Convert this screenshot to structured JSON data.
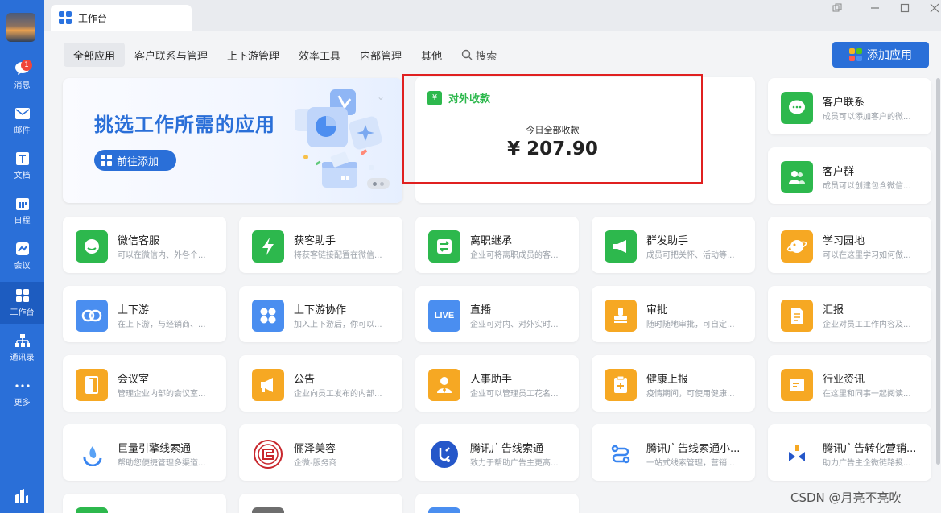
{
  "sidebar": {
    "items": [
      {
        "label": "消息",
        "icon": "chat-icon",
        "badge": "1"
      },
      {
        "label": "邮件",
        "icon": "mail-icon"
      },
      {
        "label": "文档",
        "icon": "document-icon"
      },
      {
        "label": "日程",
        "icon": "calendar-icon"
      },
      {
        "label": "会议",
        "icon": "meeting-icon"
      },
      {
        "label": "工作台",
        "icon": "workbench-icon",
        "active": true
      },
      {
        "label": "通讯录",
        "icon": "contacts-icon"
      },
      {
        "label": "更多",
        "icon": "more-icon"
      }
    ]
  },
  "window": {
    "tab_title": "工作台"
  },
  "filters": [
    "全部应用",
    "客户联系与管理",
    "上下游管理",
    "效率工具",
    "内部管理",
    "其他",
    "搜索"
  ],
  "add_app_label": "添加应用",
  "banner": {
    "title": "挑选工作所需的应用",
    "button_label": "前往添加"
  },
  "payment": {
    "title": "对外收款",
    "subtitle": "今日全部收款",
    "amount": "¥ 207.90",
    "accent": "#2db84d",
    "highlight": "#e02020"
  },
  "right_cards": [
    {
      "name": "客户联系",
      "desc": "成员可以添加客户的微..."
    },
    {
      "name": "客户群",
      "desc": "成员可以创建包含微信..."
    }
  ],
  "apps": [
    {
      "name": "微信客服",
      "desc": "可以在微信内、外各个...",
      "icon": "wechat-service-icon",
      "color": "green"
    },
    {
      "name": "获客助手",
      "desc": "将获客链接配置在微信...",
      "icon": "lightning-icon",
      "color": "green"
    },
    {
      "name": "离职继承",
      "desc": "企业可将离职成员的客...",
      "icon": "transfer-icon",
      "color": "green"
    },
    {
      "name": "群发助手",
      "desc": "成员可把关怀、活动等...",
      "icon": "megaphone-icon",
      "color": "green"
    },
    {
      "name": "学习园地",
      "desc": "可以在这里学习如何做...",
      "icon": "planet-icon",
      "color": "orange"
    },
    {
      "name": "上下游",
      "desc": "在上下游，与经销商、...",
      "icon": "link-icon",
      "color": "blue"
    },
    {
      "name": "上下游协作",
      "desc": "加入上下游后，你可以...",
      "icon": "grid-icon",
      "color": "blue"
    },
    {
      "name": "直播",
      "desc": "企业可对内、对外实时...",
      "icon": "live-icon",
      "color": "blue"
    },
    {
      "name": "审批",
      "desc": "随时随地审批，可自定...",
      "icon": "stamp-icon",
      "color": "orange"
    },
    {
      "name": "汇报",
      "desc": "企业对员工工作内容及...",
      "icon": "report-icon",
      "color": "orange"
    },
    {
      "name": "会议室",
      "desc": "管理企业内部的会议室...",
      "icon": "door-icon",
      "color": "orange"
    },
    {
      "name": "公告",
      "desc": "企业向员工发布的内部...",
      "icon": "announcement-icon",
      "color": "orange"
    },
    {
      "name": "人事助手",
      "desc": "企业可以管理员工花名...",
      "icon": "person-icon",
      "color": "orange"
    },
    {
      "name": "健康上报",
      "desc": "疫情期间，可使用健康...",
      "icon": "health-icon",
      "color": "orange"
    },
    {
      "name": "行业资讯",
      "desc": "在这里和同事一起阅读...",
      "icon": "news-icon",
      "color": "orange"
    },
    {
      "name": "巨量引擎线索通",
      "desc": "帮助您便捷管理多渠道...",
      "icon": "ocean-engine-icon",
      "color": "white"
    },
    {
      "name": "俪泽美容",
      "desc": "企微-服务商",
      "icon": "brand-logo-icon",
      "color": "white"
    },
    {
      "name": "腾讯广告线索通",
      "desc": "致力于帮助广告主更高...",
      "icon": "tencent-ads-icon",
      "color": "white"
    },
    {
      "name": "腾讯广告线索通小...",
      "desc": "一站式线索管理，营销...",
      "icon": "flow-icon",
      "color": "white"
    },
    {
      "name": "腾讯广告转化营销...",
      "desc": "助力广告主企微链路投...",
      "icon": "conversion-icon",
      "color": "white"
    }
  ],
  "watermark": "CSDN @月亮不亮吹"
}
